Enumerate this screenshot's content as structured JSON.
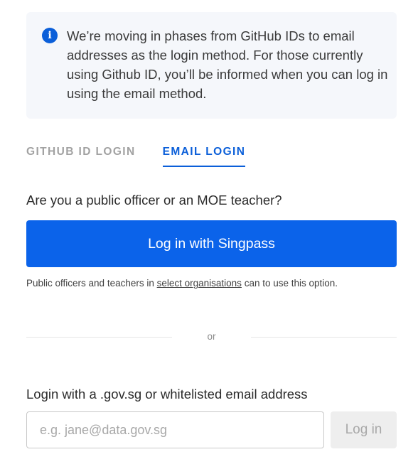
{
  "notice": {
    "icon": "info-icon",
    "icon_glyph": "i",
    "text": "We’re moving in phases from GitHub IDs to email addresses as the login method. For those currently using Github ID, you’ll be informed when you can log in using the email method."
  },
  "tabs": [
    {
      "label": "GITHUB ID LOGIN",
      "active": false
    },
    {
      "label": "EMAIL LOGIN",
      "active": true
    }
  ],
  "singpass_section": {
    "question": "Are you a public officer or an MOE teacher?",
    "button_label": "Log in with Singpass",
    "helper_prefix": "Public officers and teachers in ",
    "helper_link": "select organisations",
    "helper_suffix": " can to use this option."
  },
  "divider": {
    "label": "or"
  },
  "email_section": {
    "label": "Login with a .gov.sg or whitelisted email address",
    "input_value": "",
    "input_placeholder": "e.g. jane@data.gov.sg",
    "button_label": "Log in"
  },
  "colors": {
    "accent": "#0b5fd9",
    "primary_button": "#0b63ea",
    "notice_background": "#f5f7fb",
    "disabled_button": "#eeeeee"
  }
}
